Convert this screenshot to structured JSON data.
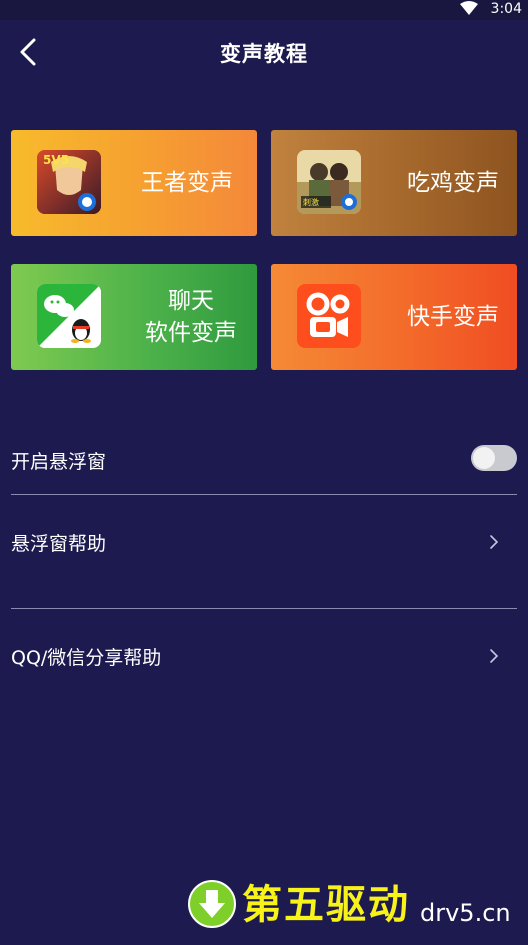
{
  "status_bar": {
    "time": "3:04"
  },
  "header": {
    "title": "变声教程"
  },
  "cards": [
    {
      "label": "王者变声",
      "icon": "honor-of-kings-icon"
    },
    {
      "label": "吃鸡变声",
      "icon": "pubg-icon"
    },
    {
      "label_line1": "聊天",
      "label_line2": "软件变声",
      "icon": "wechat-qq-icon"
    },
    {
      "label": "快手变声",
      "icon": "kuaishou-icon"
    }
  ],
  "settings": {
    "floating_window": {
      "label": "开启悬浮窗",
      "enabled": false
    },
    "floating_help": {
      "label": "悬浮窗帮助"
    },
    "share_help": {
      "label": "QQ/微信分享帮助"
    }
  },
  "watermark": {
    "main": "第五驱动",
    "domain": "drv5.cn"
  },
  "colors": {
    "background": "#1d1a4f",
    "card_wangzhe": "#f6a230",
    "card_chiji": "#a5682c",
    "card_chat": "#4db24a",
    "card_kuaishou": "#f36b2a",
    "watermark_yellow": "#f7f21a"
  }
}
